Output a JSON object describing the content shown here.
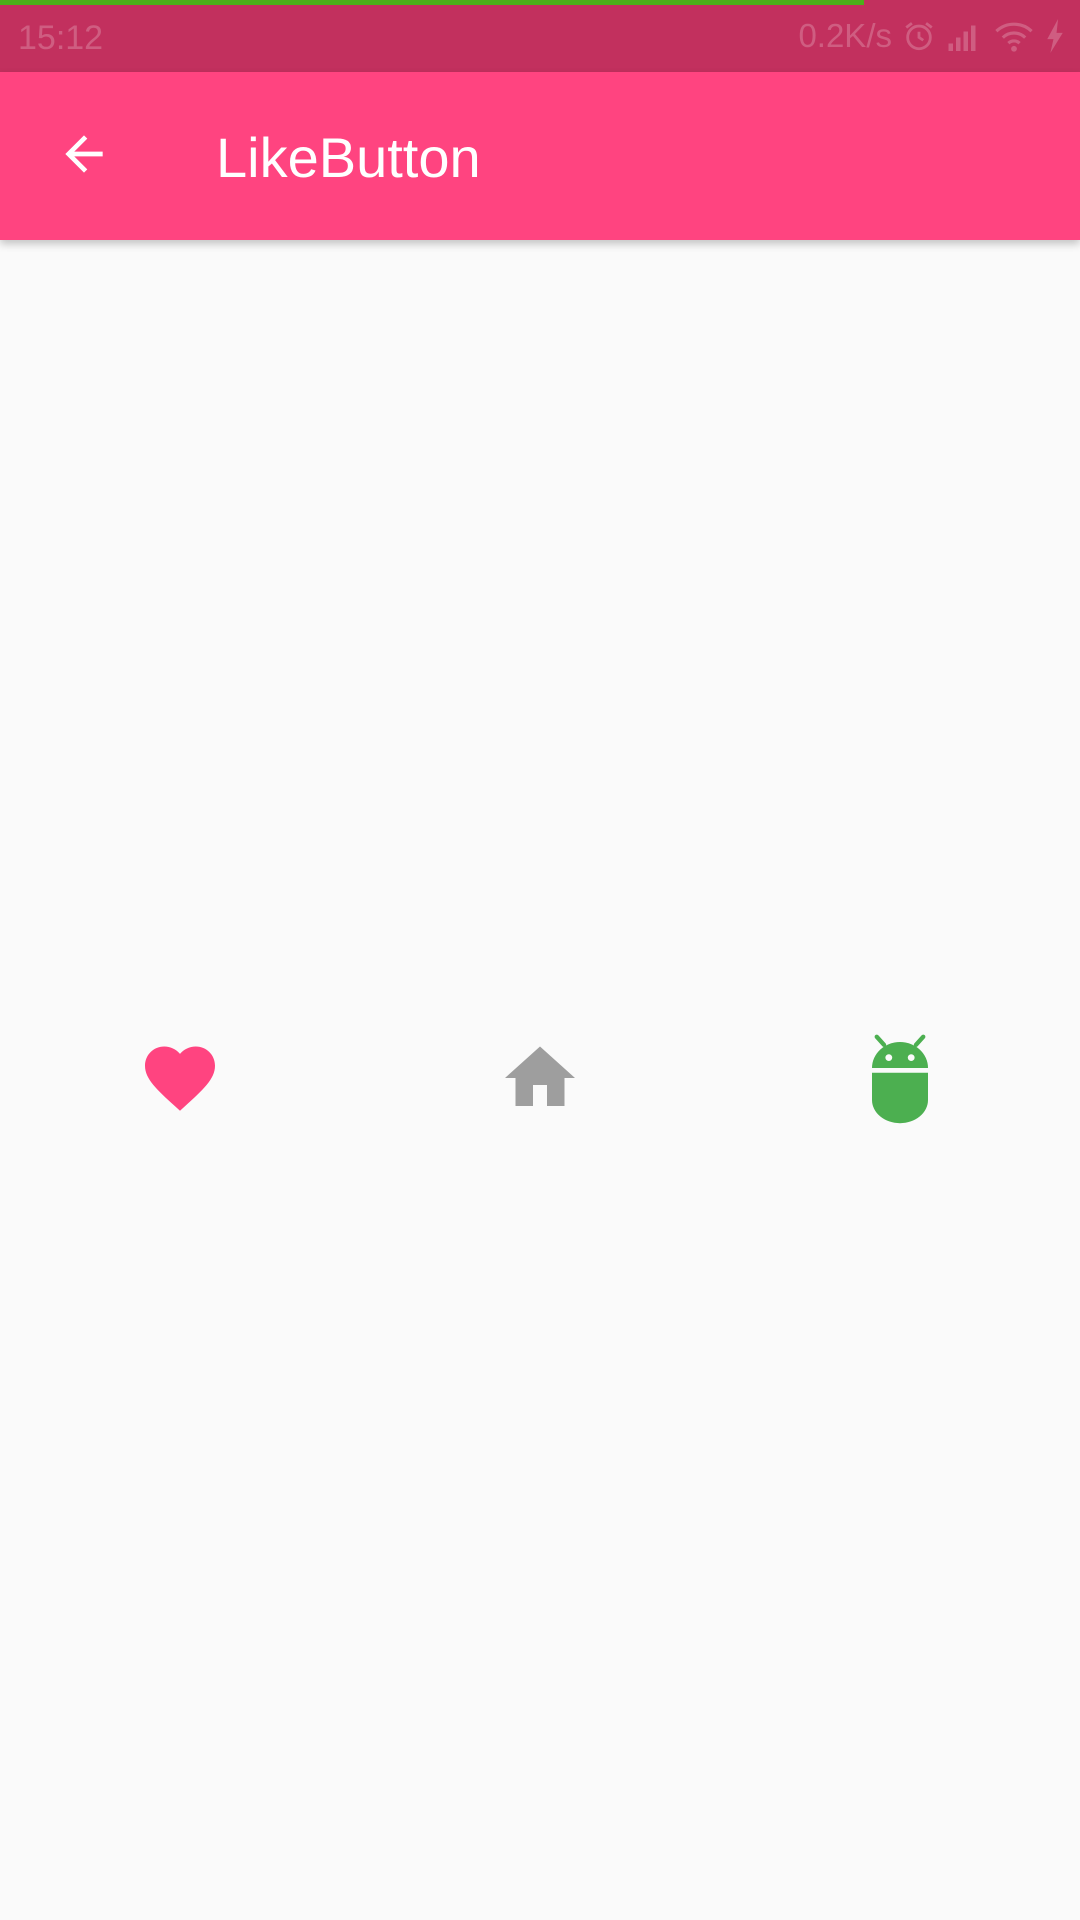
{
  "status_bar": {
    "time": "15:12",
    "net_speed": "0.2K/s",
    "icons": [
      "alarm-icon",
      "signal-icon",
      "wifi-icon",
      "charging-icon"
    ],
    "load_progress": 0.8
  },
  "app_bar": {
    "title": "LikeButton",
    "back_icon": "arrow-back-icon",
    "color": "#ff4480"
  },
  "like_buttons": [
    {
      "icon": "heart-icon",
      "color": "#ff4480"
    },
    {
      "icon": "home-icon",
      "color": "#9e9e9e"
    },
    {
      "icon": "android-icon",
      "color": "#4caf50"
    }
  ],
  "colors": {
    "status_bar": "#c2305e",
    "background": "#fafafa",
    "progress": "#4caf1a"
  }
}
